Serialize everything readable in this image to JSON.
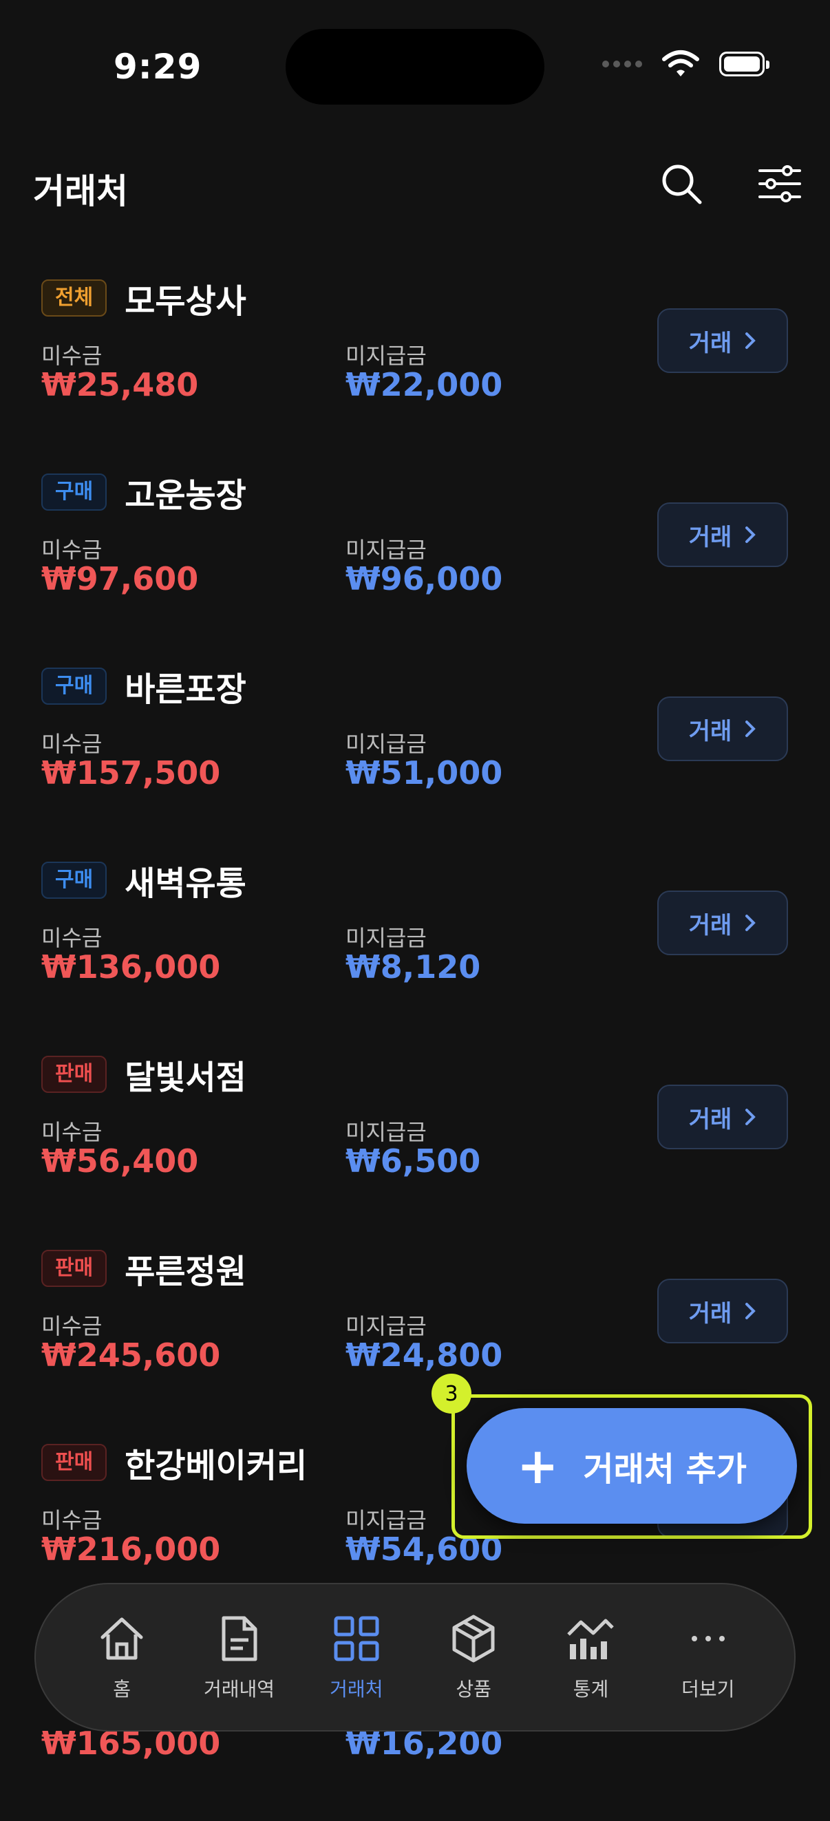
{
  "status": {
    "time": "9:29"
  },
  "header": {
    "title": "거래처"
  },
  "labels": {
    "receivable": "미수금",
    "payable": "미지급금",
    "deal": "거래"
  },
  "vendors": [
    {
      "tag": "전체",
      "tag_type": "all",
      "name": "모두상사",
      "receivable": "₩25,480",
      "payable": "₩22,000"
    },
    {
      "tag": "구매",
      "tag_type": "buy",
      "name": "고운농장",
      "receivable": "₩97,600",
      "payable": "₩96,000"
    },
    {
      "tag": "구매",
      "tag_type": "buy",
      "name": "바른포장",
      "receivable": "₩157,500",
      "payable": "₩51,000"
    },
    {
      "tag": "구매",
      "tag_type": "buy",
      "name": "새벽유통",
      "receivable": "₩136,000",
      "payable": "₩8,120"
    },
    {
      "tag": "판매",
      "tag_type": "sell",
      "name": "달빛서점",
      "receivable": "₩56,400",
      "payable": "₩6,500"
    },
    {
      "tag": "판매",
      "tag_type": "sell",
      "name": "푸른정원",
      "receivable": "₩245,600",
      "payable": "₩24,800"
    },
    {
      "tag": "판매",
      "tag_type": "sell",
      "name": "한강베이커리",
      "receivable": "₩216,000",
      "payable": "₩54,600"
    }
  ],
  "partial_row": {
    "receivable": "₩165,000",
    "payable": "₩16,200"
  },
  "fab": {
    "label": "거래처 추가",
    "badge": "3"
  },
  "tabs": [
    {
      "label": "홈",
      "icon": "home-icon"
    },
    {
      "label": "거래내역",
      "icon": "document-icon"
    },
    {
      "label": "거래처",
      "icon": "grid-icon",
      "active": true
    },
    {
      "label": "상품",
      "icon": "cube-icon"
    },
    {
      "label": "통계",
      "icon": "chart-icon"
    },
    {
      "label": "더보기",
      "icon": "more-icon"
    }
  ],
  "colors": {
    "accent": "#5b8ef0",
    "red": "#f05757",
    "highlight": "#d4f02c"
  }
}
